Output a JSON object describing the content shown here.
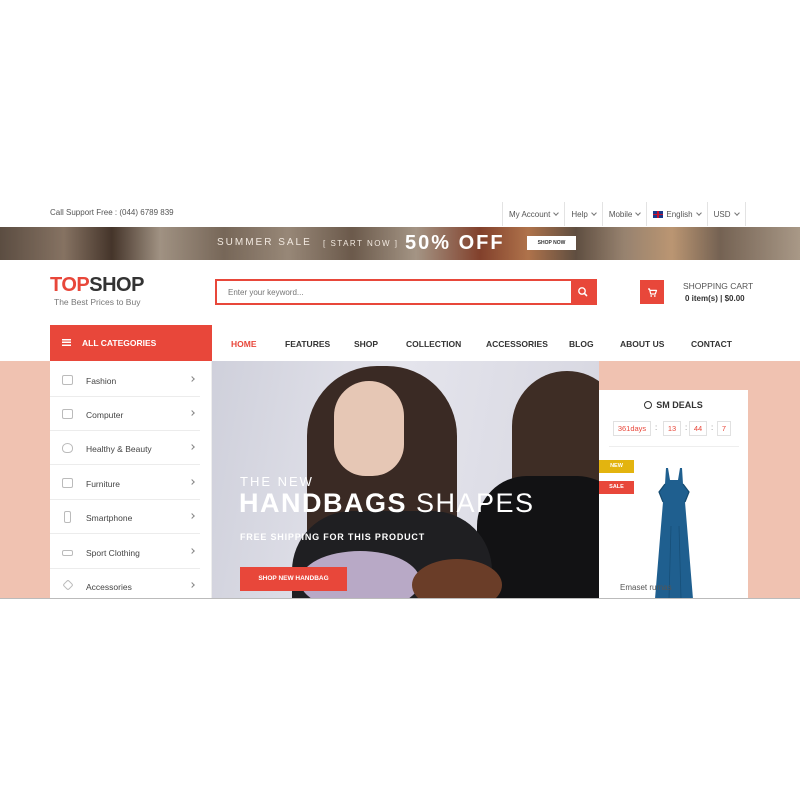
{
  "topbar": {
    "support": "Call Support Free : (044) 6789 839",
    "links": [
      {
        "label": "My Account"
      },
      {
        "label": "Help"
      },
      {
        "label": "Mobile"
      },
      {
        "label": "English"
      },
      {
        "label": "USD"
      }
    ]
  },
  "promo": {
    "summer": "SUMMER SALE",
    "start": "[ START NOW ]",
    "off": "50% OFF",
    "button": "SHOP NOW"
  },
  "header": {
    "logo_part1": "TOP",
    "logo_part2": "SHOP",
    "tagline": "The Best Prices to Buy",
    "search_placeholder": "Enter your keyword...",
    "cart_title": "SHOPPING CART",
    "cart_info": "0 item(s) | $0.00"
  },
  "nav": {
    "categories_label": "ALL CATEGORIES",
    "items": [
      {
        "label": "HOME",
        "active": true
      },
      {
        "label": "FEATURES"
      },
      {
        "label": "SHOP"
      },
      {
        "label": "COLLECTION"
      },
      {
        "label": "ACCESSORIES"
      },
      {
        "label": "BLOG"
      },
      {
        "label": "ABOUT US"
      },
      {
        "label": "CONTACT"
      }
    ]
  },
  "sidebar": {
    "items": [
      {
        "label": "Fashion",
        "icon": "gift-icon"
      },
      {
        "label": "Computer",
        "icon": "laptop-icon"
      },
      {
        "label": "Healthy & Beauty",
        "icon": "heart-icon"
      },
      {
        "label": "Furniture",
        "icon": "sofa-icon"
      },
      {
        "label": "Smartphone",
        "icon": "smartphone-icon"
      },
      {
        "label": "Sport Clothing",
        "icon": "shoe-icon"
      },
      {
        "label": "Accessories",
        "icon": "diamond-icon"
      }
    ]
  },
  "hero": {
    "subtitle": "THE NEW",
    "title_bold": "HANDBAGS",
    "title_light": " SHAPES",
    "shipping": "FREE SHIPPING FOR THIS PRODUCT",
    "button": "SHOP NEW HANDBAG"
  },
  "deals": {
    "title": "SM DEALS",
    "days": "361days",
    "hours": "13",
    "minutes": "44",
    "seconds": "7",
    "badge_new": "NEW",
    "badge_sale": "SALE",
    "product_name": "Emaset rumas"
  },
  "colors": {
    "accent": "#e8473a",
    "band": "#f0c2b1",
    "new_badge": "#e3b40f"
  }
}
